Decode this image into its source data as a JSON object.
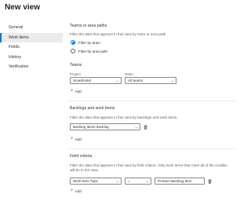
{
  "title": "New view",
  "sidebar": {
    "items": [
      {
        "label": "General"
      },
      {
        "label": "Work items"
      },
      {
        "label": "Fields"
      },
      {
        "label": "History"
      },
      {
        "label": "Verification"
      }
    ]
  },
  "teams_section": {
    "title": "Teams or area paths",
    "description": "Filter the data that appears in this view by team or area path.",
    "options": [
      "Filter by team",
      "Filter by area path"
    ]
  },
  "teams": {
    "title": "Teams",
    "project_label": "Project",
    "project_value": "SmartHotel",
    "team_label": "Team",
    "team_value": "All teams",
    "add_label": "Add"
  },
  "backlogs": {
    "title": "Backlogs and work items",
    "description": "Filter the data that appears in this view by backlogs and work items.",
    "backlog_value": "Backlog items backlog",
    "add_label": "Add"
  },
  "field_criteria": {
    "title": "Field criteria",
    "description_line1": "Filter the data that appears in this view by field criteria. Only work items that meet all of the conditio",
    "description_line2": "will be in the view.",
    "field_value": "Work Item Type",
    "operator_value": "=",
    "criteria_value": "Product Backlog Item",
    "add_label": "Add"
  },
  "colors": {
    "accent": "#0078d4",
    "selected_bg": "#edebe9",
    "text": "#323130",
    "secondary_text": "#605e5c"
  }
}
